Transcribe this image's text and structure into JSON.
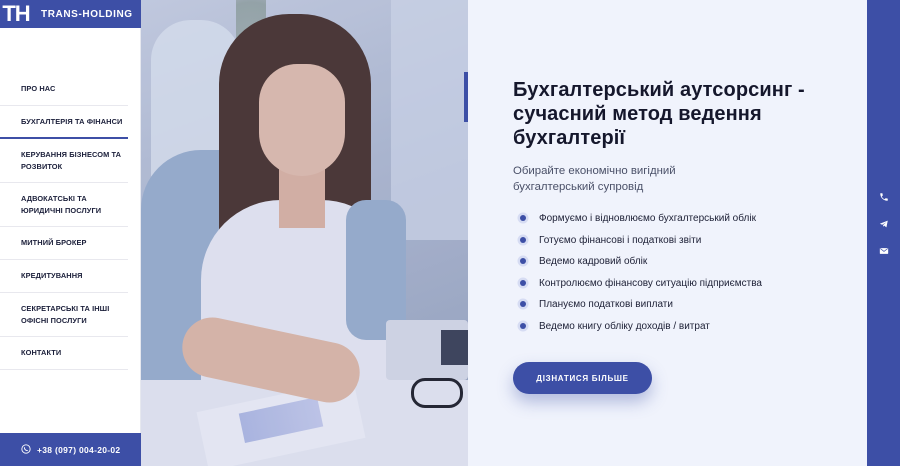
{
  "brand": {
    "mark": "TH",
    "name": "TRANS-HOLDING"
  },
  "nav": {
    "items": [
      {
        "label": "ПРО НАС"
      },
      {
        "label": "БУХГАЛТЕРІЯ ТА ФІНАНСИ"
      },
      {
        "label": "КЕРУВАННЯ БІЗНЕСОМ ТА РОЗВИТОК"
      },
      {
        "label": "АДВОКАТСЬКІ ТА ЮРИДИЧНІ ПОСЛУГИ"
      },
      {
        "label": "МИТНИЙ БРОКЕР"
      },
      {
        "label": "КРЕДИТУВАННЯ"
      },
      {
        "label": "СЕКРЕТАРСЬКІ ТА ІНШІ ОФІСНІ ПОСЛУГИ"
      },
      {
        "label": "КОНТАКТИ"
      }
    ],
    "active_index": 1
  },
  "phone": {
    "number": "+38 (097) 004-20-02"
  },
  "hero": {
    "title": "Бухгалтерський аутсорсинг - сучасний метод ведення бухгалтерії",
    "subtitle": "Обирайте економічно вигідний бухгалтерський супровід",
    "features": [
      "Формуємо і відновлюємо бухгалтерський облік",
      "Готуємо фінансові і податкові звіти",
      "Ведемо кадровий облік",
      "Контролюємо фінансову ситуацію підприємства",
      "Плануємо податкові виплати",
      "Ведемо книгу обліку доходів / витрат"
    ],
    "cta_label": "ДІЗНАТИСЯ БІЛЬШЕ"
  },
  "rail": {
    "icons": [
      "phone-icon",
      "telegram-icon",
      "mail-icon"
    ]
  },
  "colors": {
    "brand": "#3d4fa6",
    "content_bg": "#f0f3fc",
    "text_dark": "#15172c"
  }
}
